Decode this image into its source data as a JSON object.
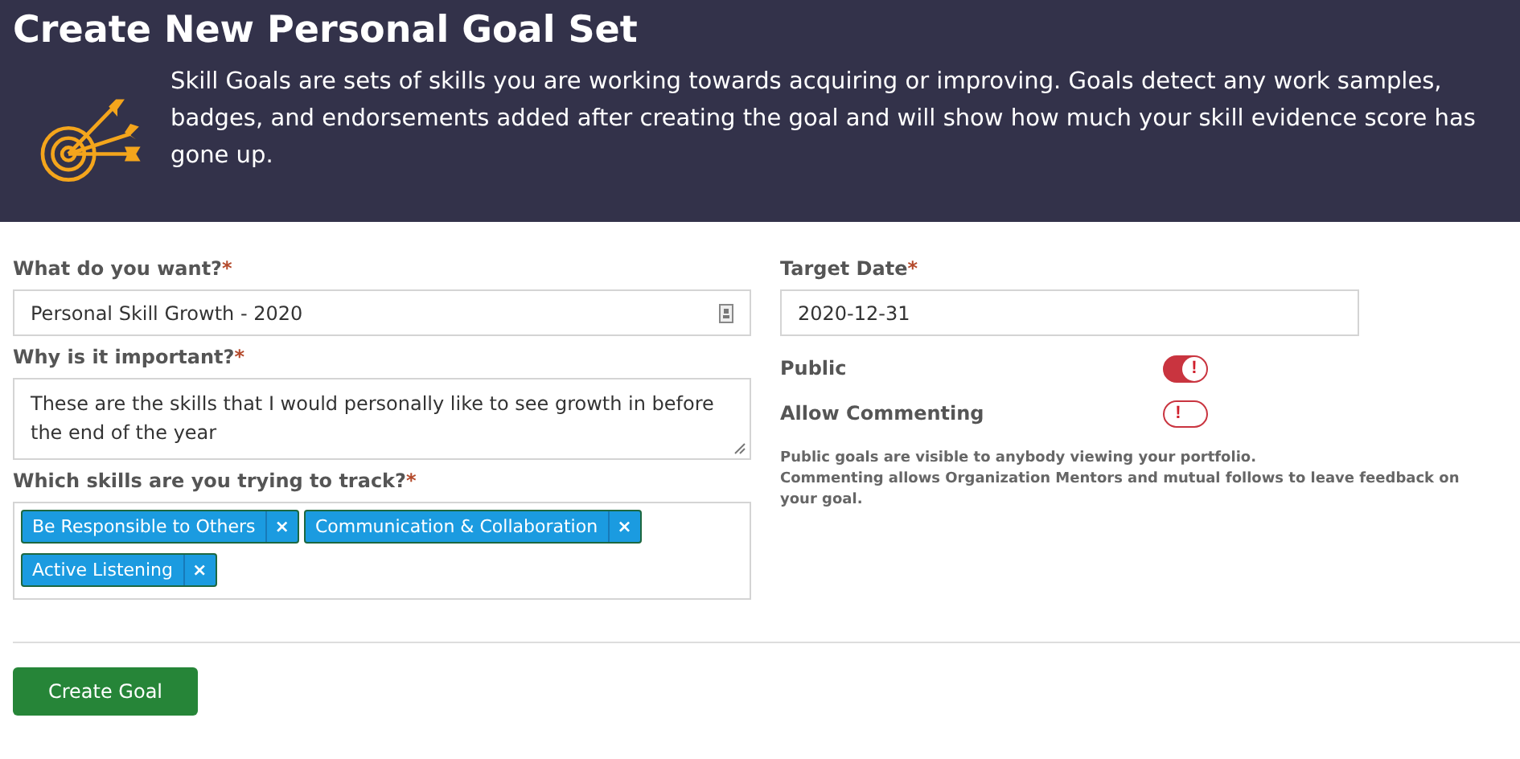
{
  "header": {
    "title": "Create New Personal Goal Set",
    "description": "Skill Goals are sets of skills you are working towards acquiring or improving. Goals detect any work samples, badges, and endorsements added after creating the goal and will show how much your skill evidence score has gone up."
  },
  "left": {
    "goal": {
      "label": "What do you want?",
      "required_mark": "*",
      "value": "Personal Skill Growth - 2020"
    },
    "reason": {
      "label": "Why is it important?",
      "required_mark": "*",
      "value": "These are the skills that I would personally like to see growth in before the end of the year"
    },
    "skills": {
      "label": "Which skills are you trying to track?",
      "required_mark": "*",
      "remove_glyph": "×",
      "tags": [
        {
          "label": "Be Responsible to Others"
        },
        {
          "label": "Communication & Collaboration"
        },
        {
          "label": "Active Listening"
        }
      ]
    }
  },
  "right": {
    "target_date": {
      "label": "Target Date",
      "required_mark": "*",
      "value": "2020-12-31"
    },
    "toggles": [
      {
        "label": "Public",
        "on": true,
        "glyph": "!"
      },
      {
        "label": "Allow Commenting",
        "on": false,
        "glyph": "!"
      }
    ],
    "notes": [
      "Public goals are visible to anybody viewing your portfolio.",
      "Commenting allows Organization Mentors and mutual follows to leave feedback on your goal."
    ]
  },
  "submit": {
    "label": "Create Goal"
  }
}
